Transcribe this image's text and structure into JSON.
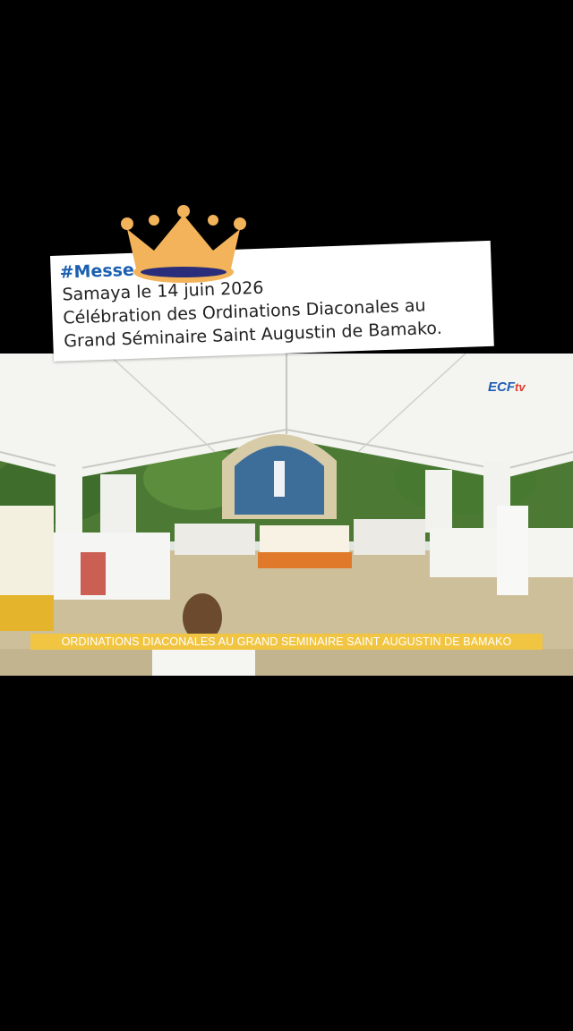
{
  "caption": {
    "hashtag": "#Messe",
    "line1": "Samaya le 14 juin 2026",
    "line2": "Célébration des Ordinations Diaconales au",
    "line3": "Grand Séminaire Saint Augustin de Bamako."
  },
  "video": {
    "ticker": "ORDINATIONS DIACONALES AU GRAND SEMINAIRE SAINT AUGUSTIN DE BAMAKO",
    "logo": "ECF",
    "logo_suffix": "tv"
  },
  "decorations": {
    "crown_icon": "crown-icon",
    "crown_color": "#f2b35a",
    "band_color": "#2a2e7a"
  }
}
